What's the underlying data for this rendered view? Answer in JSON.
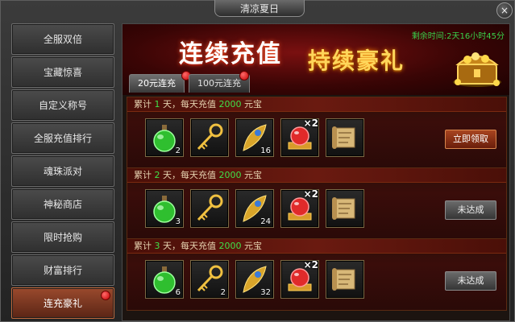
{
  "window": {
    "title": "清凉夏日",
    "close_label": "×"
  },
  "sidebar": {
    "items": [
      {
        "label": "全服双倍"
      },
      {
        "label": "宝藏惊喜"
      },
      {
        "label": "自定义称号"
      },
      {
        "label": "全服充值排行"
      },
      {
        "label": "魂珠派对"
      },
      {
        "label": "神秘商店"
      },
      {
        "label": "限时抢购"
      },
      {
        "label": "财富排行"
      },
      {
        "label": "连充豪礼",
        "active": true,
        "has_dot": true
      }
    ]
  },
  "banner": {
    "title_part1": "连续充值",
    "title_part2": "持续豪礼",
    "countdown": "剩余时间:2天16小时45分"
  },
  "tabs": [
    {
      "label": "20元连充",
      "active": true,
      "has_dot": true
    },
    {
      "label": "100元连充",
      "active": false,
      "has_dot": true
    }
  ],
  "rows": [
    {
      "head": {
        "prefix": "累计",
        "days": "1",
        "mid": "天，每天充值",
        "amount": "2000",
        "suffix": "元宝"
      },
      "items": [
        {
          "icon": "green-potion-icon",
          "count": "2"
        },
        {
          "icon": "golden-key-icon",
          "count": ""
        },
        {
          "icon": "phoenix-feather-icon",
          "count": "16"
        },
        {
          "icon": "red-orb-icon",
          "badge": "×2"
        },
        {
          "icon": "scroll-icon",
          "count": ""
        }
      ],
      "button": {
        "label": "立即领取",
        "type": "claim"
      }
    },
    {
      "head": {
        "prefix": "累计",
        "days": "2",
        "mid": "天，每天充值",
        "amount": "2000",
        "suffix": "元宝"
      },
      "items": [
        {
          "icon": "green-potion-icon",
          "count": "3"
        },
        {
          "icon": "golden-key-icon",
          "count": ""
        },
        {
          "icon": "phoenix-feather-icon",
          "count": "24"
        },
        {
          "icon": "red-orb-icon",
          "badge": "×2"
        },
        {
          "icon": "scroll-icon",
          "count": ""
        }
      ],
      "button": {
        "label": "未达成",
        "type": "notyet"
      }
    },
    {
      "head": {
        "prefix": "累计",
        "days": "3",
        "mid": "天，每天充值",
        "amount": "2000",
        "suffix": "元宝"
      },
      "items": [
        {
          "icon": "green-potion-icon",
          "count": "6"
        },
        {
          "icon": "golden-key-icon",
          "count": "2"
        },
        {
          "icon": "phoenix-feather-icon",
          "count": "32"
        },
        {
          "icon": "red-orb-icon",
          "badge": "×2"
        },
        {
          "icon": "scroll-icon",
          "count": ""
        }
      ],
      "button": {
        "label": "未达成",
        "type": "notyet"
      }
    }
  ]
}
